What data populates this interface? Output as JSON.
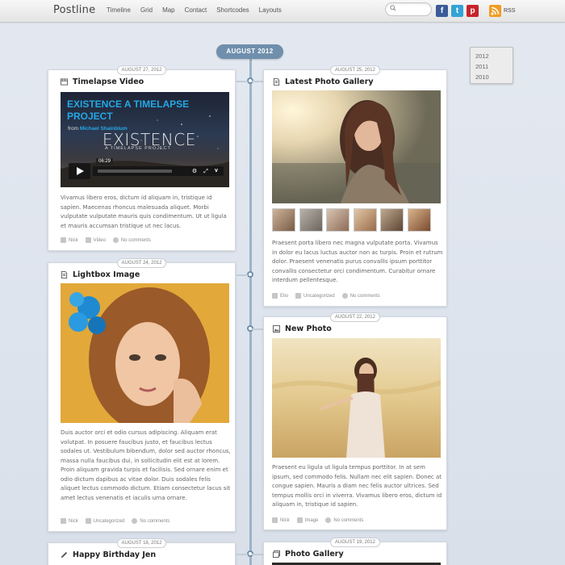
{
  "header": {
    "logo": "Postline",
    "nav": [
      "Timeline",
      "Grid",
      "Map",
      "Contact",
      "Shortcodes",
      "Layouts"
    ],
    "search_placeholder": "",
    "social": [
      {
        "name": "facebook",
        "glyph": "f",
        "color": "#3b5b99"
      },
      {
        "name": "twitter",
        "glyph": "t",
        "color": "#32a3d6"
      },
      {
        "name": "pinterest",
        "glyph": "p",
        "color": "#c8232c"
      }
    ],
    "rss_label": "RSS"
  },
  "timeline": {
    "month": "AUGUST 2012",
    "years": [
      "2012",
      "2011",
      "2010"
    ]
  },
  "posts": {
    "p1": {
      "date": "AUGUST 27, 2012",
      "title": "Timelapse Video",
      "type_icon": "video-icon",
      "video": {
        "title": "EXISTENCE A TIMELAPSE PROJECT",
        "from_label": "from",
        "author": "Michael Shainblum",
        "big": "EXISTENCE",
        "sub": "A TIMELAPSE PROJECT",
        "time": "06:29"
      },
      "text": "Vivamus libero eros, dictum id aliquam in, tristique id sapien. Maecenas rhoncus malesuada aliquet. Morbi vulputate vulputate mauris quis condimentum. Ut ut ligula et mauris accumsan tristique ut nec lacus.",
      "author": "Nick",
      "category": "Video",
      "comments": "No comments"
    },
    "p2": {
      "date": "AUGUST 25, 2012",
      "title": "Latest Photo Gallery",
      "type_icon": "document-icon",
      "text": "Praesent porta libero nec magna vulputate porta. Vivamus in dolor eu lacus luctus auctor non ac turpis. Proin et rutrum dolor. Praesent venenatis purus convallis ipsum porttitor convallis consectetur orci condimentum. Curabitur ornare interdum pellentesque.",
      "author": "Elio",
      "category": "Uncategorized",
      "comments": "No comments"
    },
    "p3": {
      "date": "AUGUST 24, 2012",
      "title": "Lightbox Image",
      "type_icon": "document-icon",
      "text": "Duis auctor orci et odio cursus adipiscing. Aliquam erat volutpat. In posuere faucibus justo, et faucibus lectus sodales ut. Vestibulum bibendum, dolor sed auctor rhoncus, massa nulla faucibus dui, in sollicitudin elit est at lorem. Proin aliquam gravida turpis et facilisis. Sed ornare enim et odio dictum dapibus ac vitae dolor. Duis sodales felis aliquet lectus commodo dictum. Etiam consectetur lacus sit amet lectus venenatis et iaculis urna ornare.",
      "author": "Nick",
      "category": "Uncategorized",
      "comments": "No comments"
    },
    "p4": {
      "date": "AUGUST 22, 2012",
      "title": "New Photo",
      "type_icon": "image-icon",
      "text": "Praesent eu ligula ut ligula tempus porttitor. In at sem ipsum, sed commodo felis. Nullam nec elit sapien. Donec at congue sapien. Mauris a diam nec felis auctor ultrices. Sed tempus mollis orci in viverra. Vivamus libero eros, dictum id aliquam in, tristique id sapien.",
      "author": "Nick",
      "category": "Image",
      "comments": "No comments"
    },
    "p5": {
      "date": "AUGUST 18, 2012",
      "title": "Happy Birthday Jen",
      "type_icon": "pencil-icon"
    },
    "p6": {
      "date": "AUGUST 19, 2012",
      "title": "Photo Gallery",
      "type_icon": "gallery-icon"
    }
  },
  "colors": {
    "accent": "#6f8fac",
    "timeline_line": "#9fb2c6",
    "video_title": "#25a7e6"
  }
}
